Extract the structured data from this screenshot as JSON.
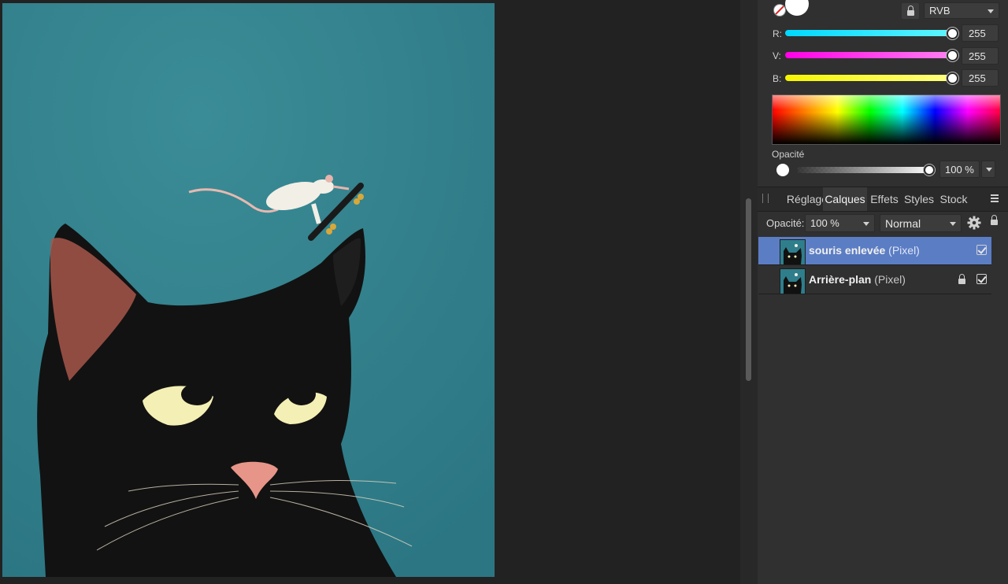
{
  "color_panel": {
    "color_model": "RVB",
    "channels": [
      {
        "label": "R:",
        "value": "255",
        "color": "#00e5ff"
      },
      {
        "label": "V:",
        "value": "255",
        "color": "#ff00ff"
      },
      {
        "label": "B:",
        "value": "255",
        "color": "#ffff00"
      }
    ],
    "opacity_label": "Opacité",
    "opacity_value": "100 %",
    "fill_color": "#ffffff",
    "fill_icon": "no-fill-icon",
    "lock_icon": "lock-icon"
  },
  "tabs": [
    {
      "label": "Réglage",
      "active": false
    },
    {
      "label": "Calques",
      "active": true
    },
    {
      "label": "Effets",
      "active": false
    },
    {
      "label": "Styles",
      "active": false
    },
    {
      "label": "Stock",
      "active": false
    }
  ],
  "layers_panel": {
    "opacity_label": "Opacité:",
    "opacity_value": "100 %",
    "blend_mode": "Normal",
    "settings_icon": "gear-icon",
    "lock_icon": "lock-icon",
    "layers": [
      {
        "name": "souris enlevée",
        "type": "(Pixel)",
        "selected": true,
        "locked": false,
        "visible": true
      },
      {
        "name": "Arrière-plan",
        "type": "(Pixel)",
        "selected": false,
        "locked": true,
        "visible": true
      }
    ]
  },
  "colors": {
    "panel_bg": "#303030",
    "selected_layer": "#5b7dc4",
    "artwork_background": "#2f7e8c"
  }
}
